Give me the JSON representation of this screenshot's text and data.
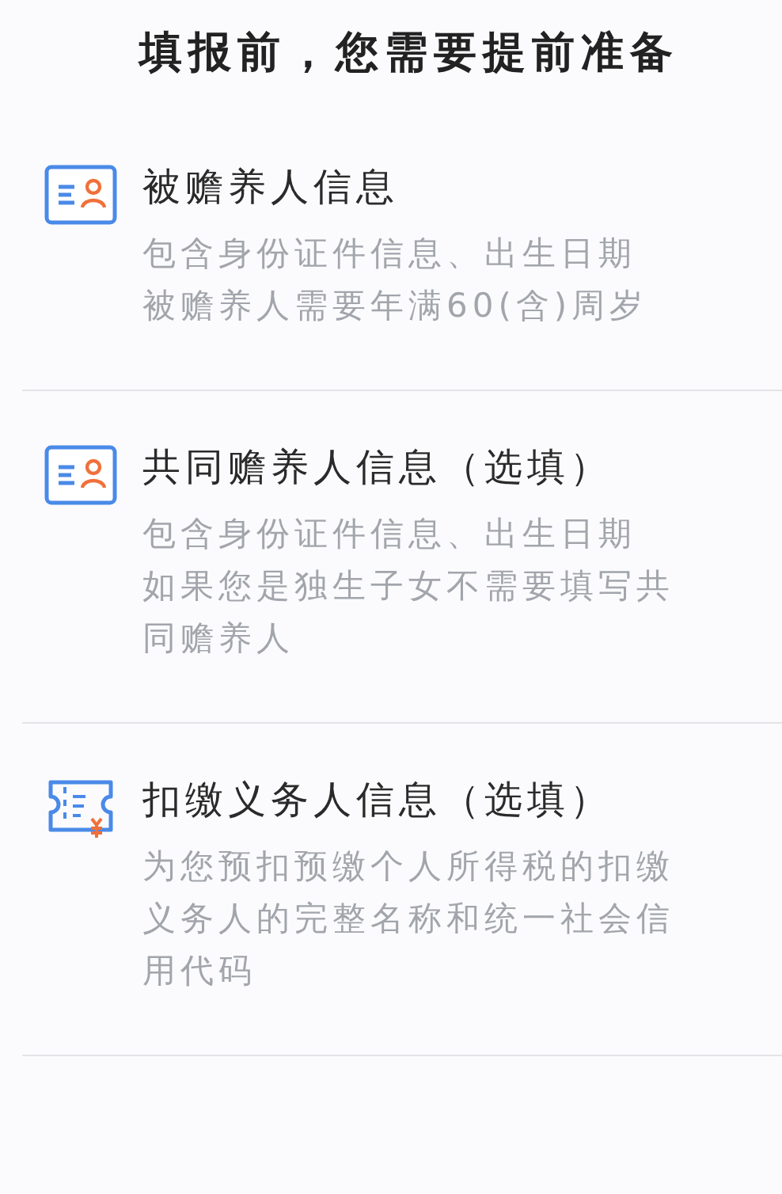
{
  "title": "填报前，您需要提前准备",
  "items": [
    {
      "kind": "id-card",
      "heading": "被赡养人信息",
      "description": [
        "包含身份证件信息、出生日期",
        "被赡养人需要年满60(含)周岁"
      ]
    },
    {
      "kind": "id-card",
      "heading": "共同赡养人信息（选填）",
      "description": [
        "包含身份证件信息、出生日期",
        "如果您是独生子女不需要填写共",
        "同赡养人"
      ]
    },
    {
      "kind": "receipt",
      "heading": "扣缴义务人信息（选填）",
      "description": [
        "为您预扣预缴个人所得税的扣缴",
        "义务人的完整名称和统一社会信",
        "用代码"
      ]
    }
  ]
}
